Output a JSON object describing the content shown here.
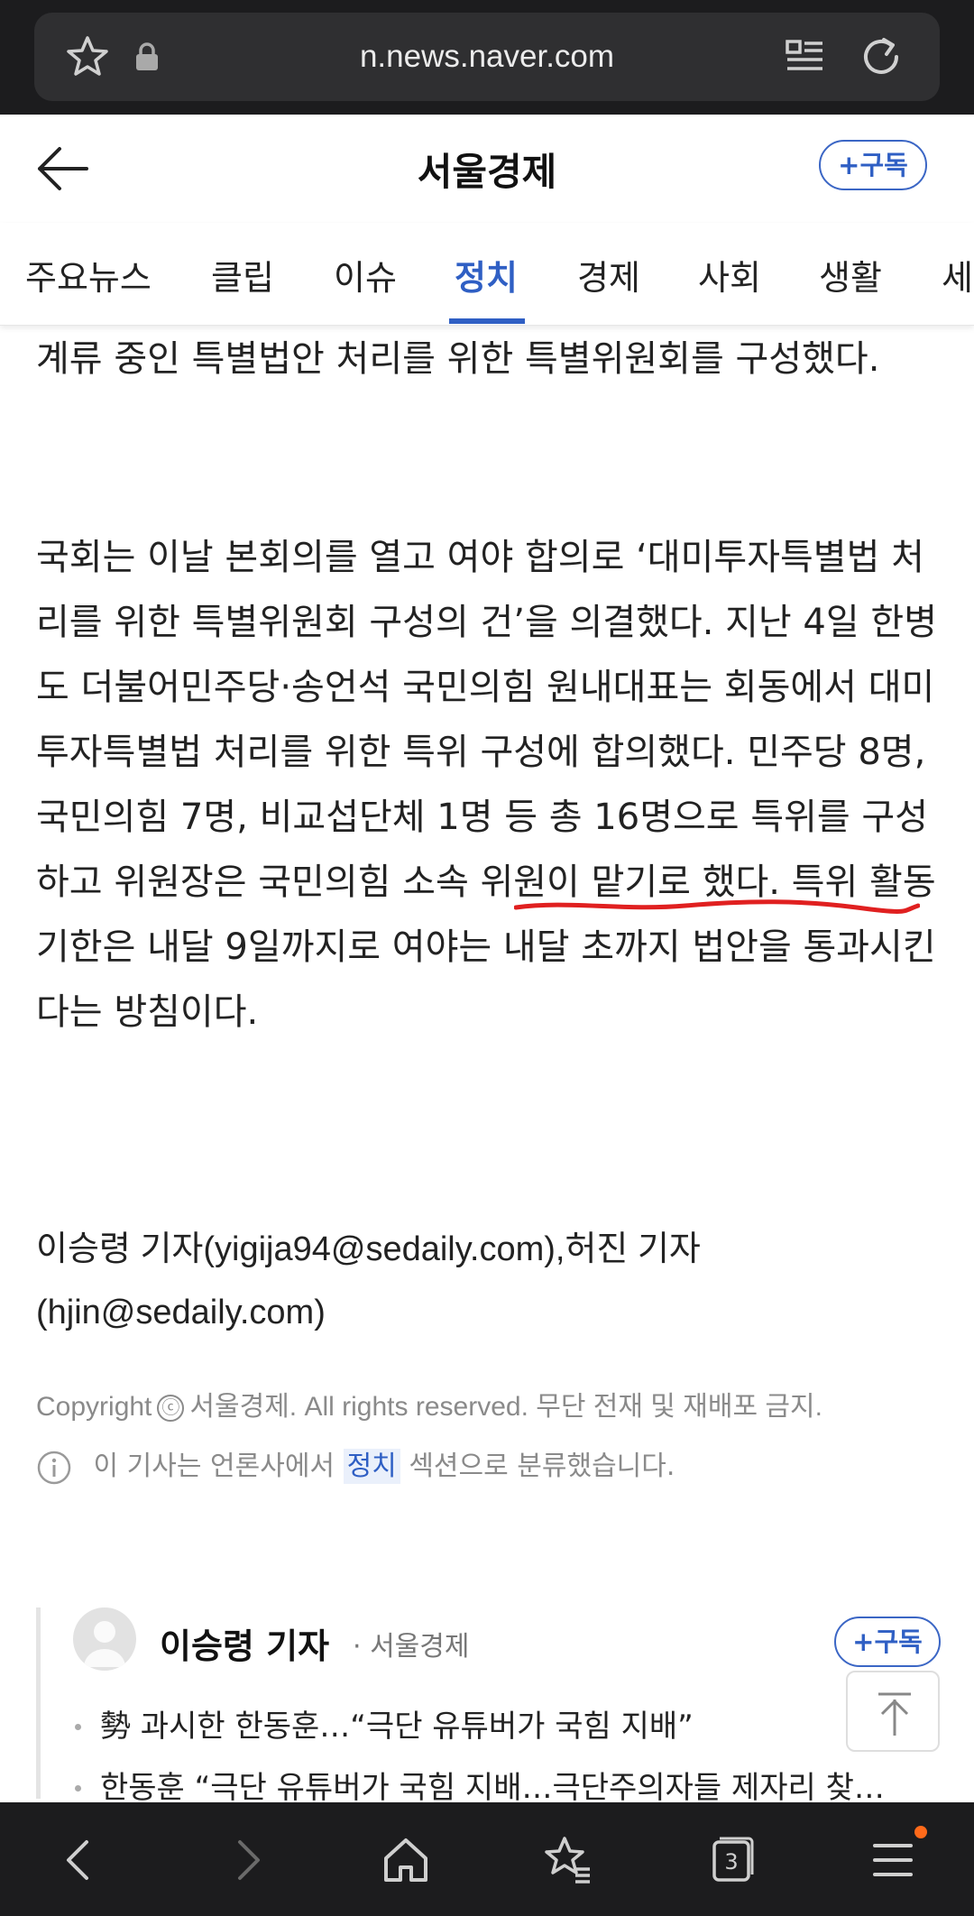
{
  "browser": {
    "url": "n.news.naver.com"
  },
  "header": {
    "press_name": "서울경제",
    "subscribe_label": "+구독"
  },
  "tabs": [
    {
      "label": "주요뉴스",
      "active": false
    },
    {
      "label": "클립",
      "active": false
    },
    {
      "label": "이슈",
      "active": false
    },
    {
      "label": "정치",
      "active": true
    },
    {
      "label": "경제",
      "active": false
    },
    {
      "label": "사회",
      "active": false
    },
    {
      "label": "생활",
      "active": false
    },
    {
      "label": "세",
      "active": false
    }
  ],
  "article": {
    "paragraph_1": "계류 중인 특별법안 처리를 위한 특별위원회를 구성했다.",
    "paragraph_2": "국회는 이날 본회의를 열고 여야 합의로 ‘대미투자특별법 처리를 위한 특별위원회 구성의 건’을 의결했다. 지난 4일 한병도 더불어민주당·송언석 국민의힘 원내대표는 회동에서 대미투자특별법 처리를 위한 특위 구성에 합의했다. 민주당 8명, 국민의힘 7명, 비교섭단체 1명 등 총 16명으로 특위를 구성하고 위원장은 국민의힘 소속 위원이 맡기로 했다. 특위 활동 기한은 내달 9일까지로 여야는 내달 초까지 법안을 통과시킨다는 방침이다.",
    "byline": "이승령 기자(yigija94@sedaily.com),허진 기자(hjin@sedaily.com)",
    "copyright_prefix": "Copyright",
    "copyright_symbol": "ⓒ",
    "copyright_text": "서울경제. All rights reserved. 무단 전재 및 재배포 금지.",
    "classify_prefix": "이 기사는 언론사에서",
    "classify_section": "정치",
    "classify_suffix": "섹션으로 분류했습니다."
  },
  "reporter": {
    "name": "이승령 기자",
    "press": "· 서울경제",
    "subscribe_label": "+구독",
    "items": [
      "勢 과시한 한동훈…“극단 유튜버가 국힘 지배”",
      "한동훈 “극단 유튜버가 국힘 지배…극단주의자들 제자리 찾…"
    ]
  },
  "bottom_nav": {
    "tab_count": "3"
  },
  "colors": {
    "accent": "#2f5fc4",
    "underline_annotation": "#e02020",
    "notification_dot": "#ff6a1a"
  }
}
